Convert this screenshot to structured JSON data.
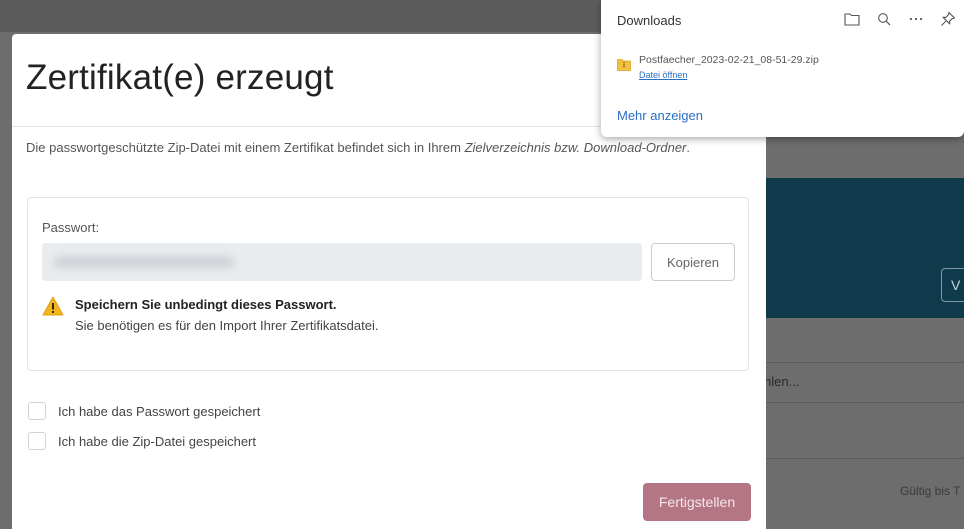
{
  "background": {
    "teal_button_label": "V",
    "select_text": "hlen...",
    "valid_text": "Gültig bis T"
  },
  "modal": {
    "title": "Zertifikat(e) erzeugt",
    "intro_text": "Die passwortgeschützte Zip-Datei mit einem Zertifikat befindet sich in Ihrem ",
    "intro_em": "Zielverzeichnis bzw. Download-Ordner",
    "intro_end": ".",
    "password_label": "Passwort:",
    "copy_button": "Kopieren",
    "warning_title": "Speichern Sie unbedingt dieses Passwort.",
    "warning_text": "Sie benötigen es für den Import Ihrer Zertifikatsdatei.",
    "checkbox_password": "Ich habe das Passwort gespeichert",
    "checkbox_zip": "Ich habe die Zip-Datei gespeichert",
    "finish_button": "Fertigstellen"
  },
  "downloads": {
    "title": "Downloads",
    "icons": [
      "folder-icon",
      "search-icon",
      "more-icon",
      "pin-icon"
    ],
    "file_name": "Postfaecher_2023-02-21_08-51-29.zip",
    "open_link": "Datei öffnen",
    "show_more": "Mehr anzeigen"
  },
  "colors": {
    "teal": "#0e3a4c",
    "finish_button": "#b47684",
    "link": "#2b6fc2",
    "warning": "#f2b51f"
  }
}
